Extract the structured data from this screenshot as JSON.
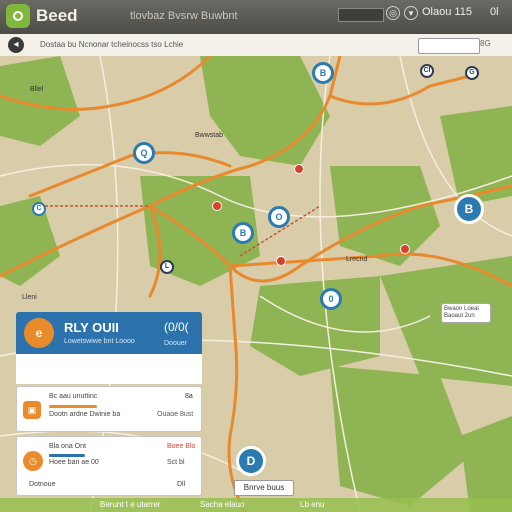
{
  "window": {
    "title": "Beed",
    "subtitle": "tlovbaz Bvsrw Buwbnt",
    "search_value": "",
    "right_label": "Olaou 115",
    "right_code": "0l"
  },
  "toolbar": {
    "back_icon": "back-icon",
    "breadcrumb": "Dostaa bu Ncnonar tcheinocss tso Lchie",
    "search_placeholder": "",
    "right_text": "8G"
  },
  "map": {
    "pins": [
      {
        "label": "B"
      },
      {
        "label": "Cl"
      },
      {
        "label": "G"
      },
      {
        "label": "Q"
      },
      {
        "label": "C"
      },
      {
        "label": "B"
      },
      {
        "label": "O"
      },
      {
        "label": "B"
      },
      {
        "label": "0"
      },
      {
        "label": "L"
      },
      {
        "label": "D"
      }
    ],
    "road_labels": [
      "Bllel",
      "Bwwstab",
      "Lleni",
      "Lrecnd"
    ],
    "callout": {
      "line1": "Bwaon Loeal",
      "line2": "Baoaut 2un"
    },
    "colors": {
      "green": "#8fb454",
      "land": "#d8cba7",
      "road": "#e8892e",
      "water_blue": "#2b7bb0"
    }
  },
  "panel": {
    "logo": "e",
    "title": "RLY OUII",
    "subtitle": "Lowetswiwe bnt Loooo",
    "code": "(0/0(",
    "code_sub": "Doouer",
    "card1": {
      "line1": "Bc aau unuttinc",
      "line2": "Dootn ardne Dwinie ba",
      "right": "8a",
      "right2": "Ouaoe 8ust"
    },
    "card2": {
      "line1": "Bla ona Ont",
      "line2": "Hoee ban ae 00",
      "line3": "Dotnoue",
      "right": "Boee Blo",
      "right2": "Sct bl",
      "right3": "Dll"
    }
  },
  "footer": {
    "left": "Berunt t e utarrer",
    "mid": "Sacha elauo",
    "right": "Lb enu"
  },
  "route_button": "Bnrve buus"
}
